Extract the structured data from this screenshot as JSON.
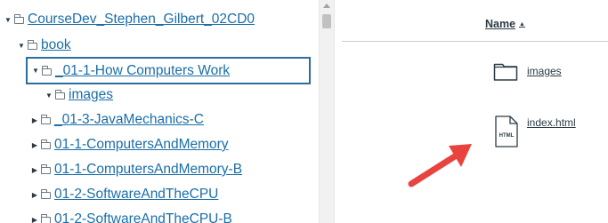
{
  "tree": {
    "items": [
      {
        "label": "CourseDev_Stephen_Gilbert_02CD0",
        "caret": "▼",
        "level": 0
      },
      {
        "label": "book",
        "caret": "▼",
        "level": 1
      },
      {
        "label": "_01-1-How Computers Work",
        "caret": "▼",
        "level": 2,
        "selected": true
      },
      {
        "label": "images",
        "caret": "▼",
        "level": 3
      },
      {
        "label": "_01-3-JavaMechanics-C",
        "caret": "▶",
        "level": 2
      },
      {
        "label": "01-1-ComputersAndMemory",
        "caret": "▶",
        "level": 2
      },
      {
        "label": "01-1-ComputersAndMemory-B",
        "caret": "▶",
        "level": 2
      },
      {
        "label": "01-2-SoftwareAndTheCPU",
        "caret": "▶",
        "level": 2
      },
      {
        "label": "01-2-SoftwareAndTheCPU-B",
        "caret": "▶",
        "level": 2
      }
    ]
  },
  "files": {
    "header": {
      "name_label": "Name",
      "sort_icon": "▲"
    },
    "items": [
      {
        "name": "images",
        "icon": "folder-icon"
      },
      {
        "name": "index.html",
        "icon": "html-file-icon",
        "icon_text": "HTML"
      }
    ]
  },
  "annotation": {
    "arrow_color": "#e8433f"
  },
  "colors": {
    "link": "#1a6ea8",
    "selected_border": "#2a6e9e",
    "text": "#2d3b45"
  }
}
